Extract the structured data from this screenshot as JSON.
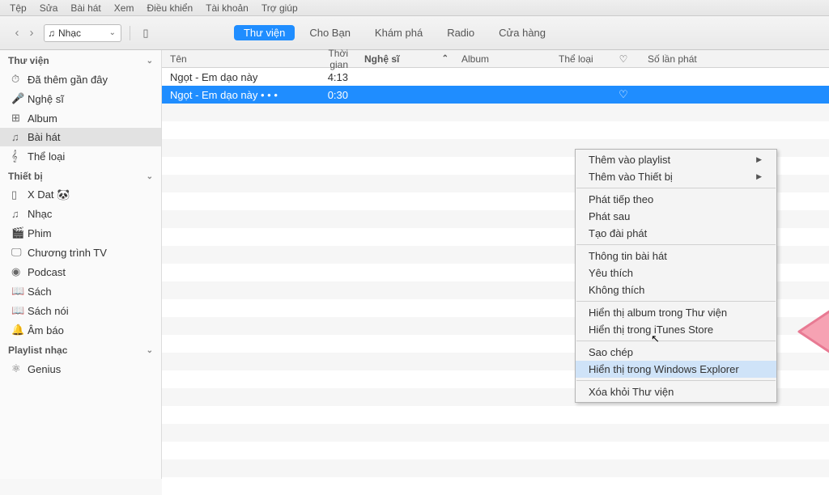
{
  "menubar": [
    "Tệp",
    "Sửa",
    "Bài hát",
    "Xem",
    "Điều khiển",
    "Tài khoản",
    "Trợ giúp"
  ],
  "media_selector": {
    "icon": "♫",
    "label": "Nhạc"
  },
  "tabs": [
    {
      "label": "Thư viện",
      "active": true
    },
    {
      "label": "Cho Bạn",
      "active": false
    },
    {
      "label": "Khám phá",
      "active": false
    },
    {
      "label": "Radio",
      "active": false
    },
    {
      "label": "Cửa hàng",
      "active": false
    }
  ],
  "sidebar": {
    "groups": [
      {
        "title": "Thư viện",
        "items": [
          {
            "icon": "⏱",
            "label": "Đã thêm gần đây"
          },
          {
            "icon": "🎤",
            "label": "Nghệ sĩ"
          },
          {
            "icon": "⊞",
            "label": "Album"
          },
          {
            "icon": "♫",
            "label": "Bài hát",
            "active": true
          },
          {
            "icon": "𝄞",
            "label": "Thể loại"
          }
        ]
      },
      {
        "title": "Thiết bị",
        "items": [
          {
            "icon": "▯",
            "label": "X Dat 🐼"
          },
          {
            "icon": "♫",
            "label": "Nhạc"
          },
          {
            "icon": "🎬",
            "label": "Phim"
          },
          {
            "icon": "🖵",
            "label": "Chương trình TV"
          },
          {
            "icon": "◉",
            "label": "Podcast"
          },
          {
            "icon": "📖",
            "label": "Sách"
          },
          {
            "icon": "📖",
            "label": "Sách nói"
          },
          {
            "icon": "🔔",
            "label": "Âm báo"
          }
        ]
      },
      {
        "title": "Playlist nhạc",
        "items": [
          {
            "icon": "⚛",
            "label": "Genius"
          }
        ]
      }
    ]
  },
  "columns": {
    "name": "Tên",
    "time": "Thời gian",
    "artist": "Nghệ sĩ",
    "album": "Album",
    "genre": "Thể loại",
    "heart": "♡",
    "plays": "Số lần phát"
  },
  "rows": [
    {
      "name": "Ngọt - Em dạo này",
      "time": "4:13",
      "selected": false
    },
    {
      "name": "Ngọt - Em dạo này • • •",
      "time": "0:30",
      "selected": true,
      "heart": "♡"
    }
  ],
  "context_menu": [
    {
      "label": "Thêm vào playlist",
      "sub": true
    },
    {
      "label": "Thêm vào Thiết bị",
      "sub": true
    },
    {
      "sep": true
    },
    {
      "label": "Phát tiếp theo"
    },
    {
      "label": "Phát sau"
    },
    {
      "label": "Tạo đài phát"
    },
    {
      "sep": true
    },
    {
      "label": "Thông tin bài hát"
    },
    {
      "label": "Yêu thích"
    },
    {
      "label": "Không thích"
    },
    {
      "sep": true
    },
    {
      "label": "Hiển thị album trong Thư viện"
    },
    {
      "label": "Hiển thị trong iTunes Store"
    },
    {
      "sep": true
    },
    {
      "label": "Sao chép"
    },
    {
      "label": "Hiển thị trong Windows Explorer",
      "hover": true
    },
    {
      "sep": true
    },
    {
      "label": "Xóa khỏi Thư viện"
    }
  ]
}
